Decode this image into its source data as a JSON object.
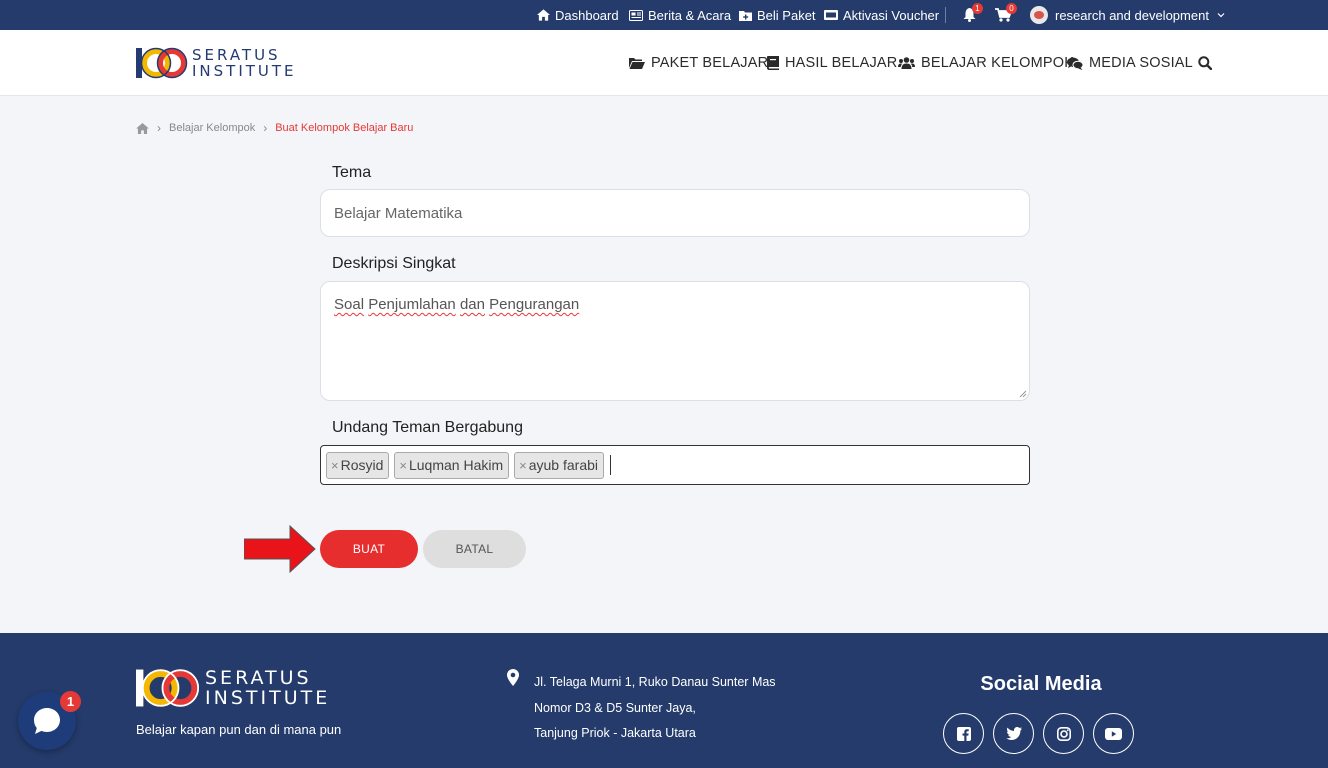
{
  "topbar": {
    "dashboard": "Dashboard",
    "berita": "Berita & Acara",
    "beli_paket": "Beli Paket",
    "aktivasi": "Aktivasi Voucher",
    "notif_count": "1",
    "cart_count": "0",
    "user_name": "research and development"
  },
  "brand": {
    "line1": "SERATUS",
    "line2": "INSTITUTE",
    "colors": {
      "navy": "#233a73",
      "red": "#e53935",
      "yellow": "#f5b800"
    }
  },
  "nav": {
    "paket": "PAKET BELAJAR",
    "hasil": "HASIL BELAJAR",
    "kelompok": "BELAJAR KELOMPOK",
    "media": "MEDIA SOSIAL"
  },
  "breadcrumb": {
    "items": [
      "Belajar Kelompok",
      "Buat Kelompok Belajar Baru"
    ]
  },
  "form": {
    "tema_label": "Tema",
    "tema_value": "Belajar Matematika",
    "deskripsi_label": "Deskripsi Singkat",
    "deskripsi_words": [
      "Soal",
      "Penjumlahan",
      "dan",
      "Pengurangan"
    ],
    "undang_label": "Undang Teman Bergabung",
    "tags": [
      "Rosyid",
      "Luqman Hakim",
      "ayub farabi"
    ],
    "buat_label": "BUAT",
    "batal_label": "BATAL"
  },
  "footer": {
    "tagline": "Belajar kapan pun dan di mana pun",
    "address_lines": [
      "Jl. Telaga Murni 1, Ruko Danau Sunter Mas",
      "Nomor D3 & D5 Sunter Jaya,",
      "Tanjung Priok - Jakarta Utara"
    ],
    "social_title": "Social Media",
    "social_icons": [
      "facebook-icon",
      "twitter-icon",
      "instagram-icon",
      "youtube-icon"
    ]
  },
  "chat": {
    "badge": "1"
  },
  "colors": {
    "accent": "#e62e2e",
    "topbar": "#243b6b"
  }
}
